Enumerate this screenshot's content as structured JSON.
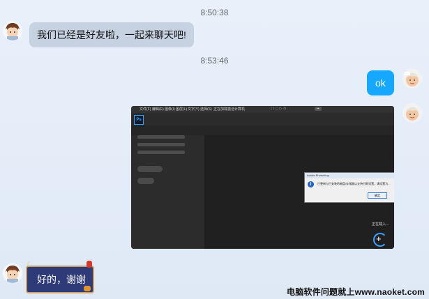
{
  "messages": {
    "time1": "8:50:38",
    "msg1": "我们已经是好友啦，一起来聊天吧!",
    "time2": "8:53:46",
    "msg2": "ok",
    "msg3": "好的，谢谢"
  },
  "screenshot": {
    "menu": [
      "文件(F)",
      "编辑(E)",
      "图像(I)",
      "图层(L)",
      "文字(Y)",
      "选择(S)"
    ],
    "app_logo": "Ps",
    "tab_title": "正在加载激活计算机",
    "dialog_title": "Adobe Photoshop",
    "dialog_text": "已更新与已安装的磁盘/存储器以支持日期设置，请设置为...",
    "dialog_button": "确定",
    "loading_text": "正在载入..."
  },
  "watermark": "电脑软件问题就上www.naoket.com"
}
